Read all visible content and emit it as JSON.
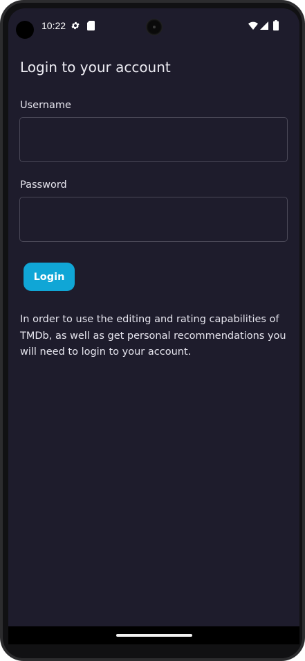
{
  "status_bar": {
    "time": "10:22",
    "icons": [
      "settings-icon",
      "sd-card-icon",
      "wifi-icon",
      "cell-signal-icon",
      "battery-icon"
    ]
  },
  "page": {
    "title": "Login to your account"
  },
  "form": {
    "username_label": "Username",
    "username_value": "",
    "password_label": "Password",
    "password_value": "",
    "login_label": "Login"
  },
  "info": {
    "text": "In order to use the editing and rating capabilities of TMDb, as well as get personal recommendations you will need to login to your account."
  },
  "colors": {
    "background": "#1e1c2c",
    "accent": "#10a6d6",
    "text": "#e6e5ee",
    "field_border": "#4b4958"
  }
}
